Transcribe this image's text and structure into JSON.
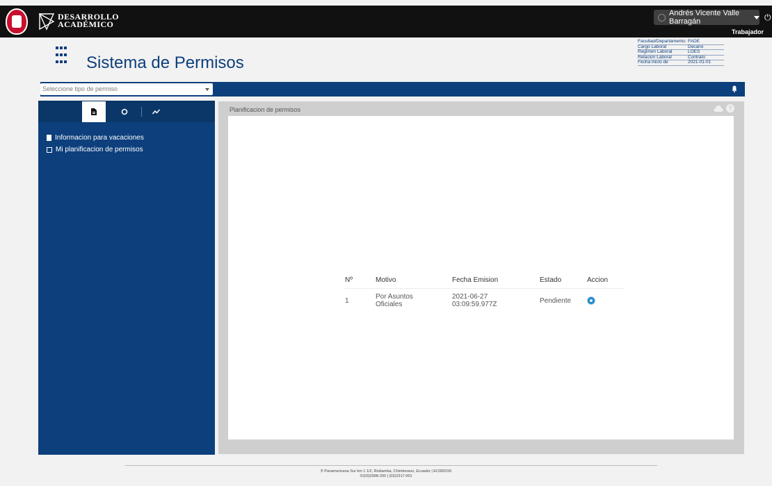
{
  "brand": {
    "line1": "DESARROLLO",
    "line2": "ACADÉMICO"
  },
  "user": {
    "name": "Andrés Vicente Valle Barragán",
    "role": "Trabajador"
  },
  "page": {
    "title": "Sistema de Permisos"
  },
  "info": [
    {
      "key": "Facultad/Departamento:",
      "value": "FADE"
    },
    {
      "key": "Cargo Laboral",
      "value": "Decano"
    },
    {
      "key": "Regimen Laboral",
      "value": "LOES"
    },
    {
      "key": "Relacion Laboral",
      "value": "Contrato"
    },
    {
      "key": "Fecha inicio de",
      "value": "2021-01-01"
    }
  ],
  "permit_select": {
    "placeholder": "Seleccione tipo de permiso"
  },
  "sidebar": {
    "links": [
      {
        "label": "Informacion para vacaciones",
        "icon": "document-icon"
      },
      {
        "label": "Mi planificacion de permisos",
        "icon": "calendar-icon"
      }
    ]
  },
  "main": {
    "title": "Planificacion de permisos",
    "table": {
      "headers": [
        "Nº",
        "Motivo",
        "Fecha Emision",
        "Estado",
        "Accion"
      ],
      "rows": [
        {
          "num": "1",
          "motivo": "Por Asuntos Oficiales",
          "fecha": "2021-06-27 03:09:59.977Z",
          "estado": "Pendiente",
          "accion_icon": "eye-icon"
        }
      ]
    }
  },
  "footer": {
    "address": "Panamericana Sur km 1 1/2, Riobamba, Chimborazo, Ecuador | EC060155",
    "phones": "(03)2998-200 | (03)2317-001"
  },
  "colors": {
    "primary": "#0d3f7c",
    "topbar": "#111111",
    "accent": "#1e88c9"
  }
}
